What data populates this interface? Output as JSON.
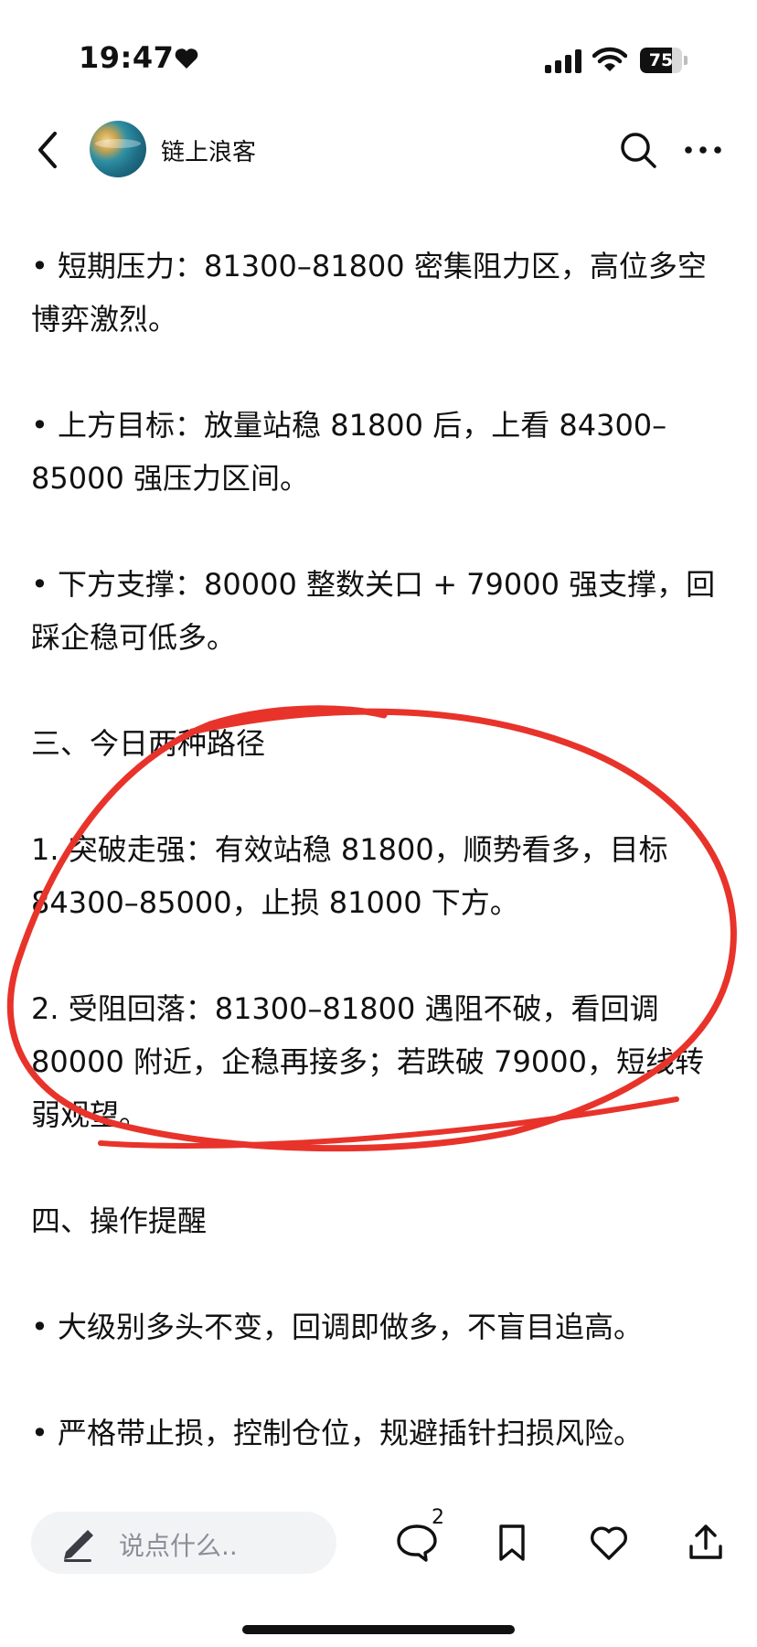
{
  "status_bar": {
    "time": "19:47",
    "battery": "75",
    "battery_level": 0.75
  },
  "header": {
    "author": "链上浪客"
  },
  "content": {
    "paragraphs": [
      "• 短期压力：81300–81800 密集阻力区，高位多空博弈激烈。",
      "• 上方目标：放量站稳 81800 后，上看 84300–85000 强压力区间。",
      "• 下方支撑：80000 整数关口 + 79000 强支撑，回踩企稳可低多。",
      "三、今日两种路径",
      "1. 突破走强：有效站稳 81800，顺势看多，目标 84300–85000，止损 81000 下方。",
      "2. 受阻回落：81300–81800 遇阻不破，看回调 80000 附近，企稳再接多；若跌破 79000，短线转弱观望。",
      "四、操作提醒",
      "• 大级别多头不变，回调即做多，不盲目追高。",
      "• 严格带止损，控制仓位，规避插针扫损风险。"
    ]
  },
  "bottom_bar": {
    "comment_placeholder": "说点什么..",
    "comment_count": "2"
  },
  "colors": {
    "annotation": "#e8332b",
    "accent": "#111111"
  }
}
